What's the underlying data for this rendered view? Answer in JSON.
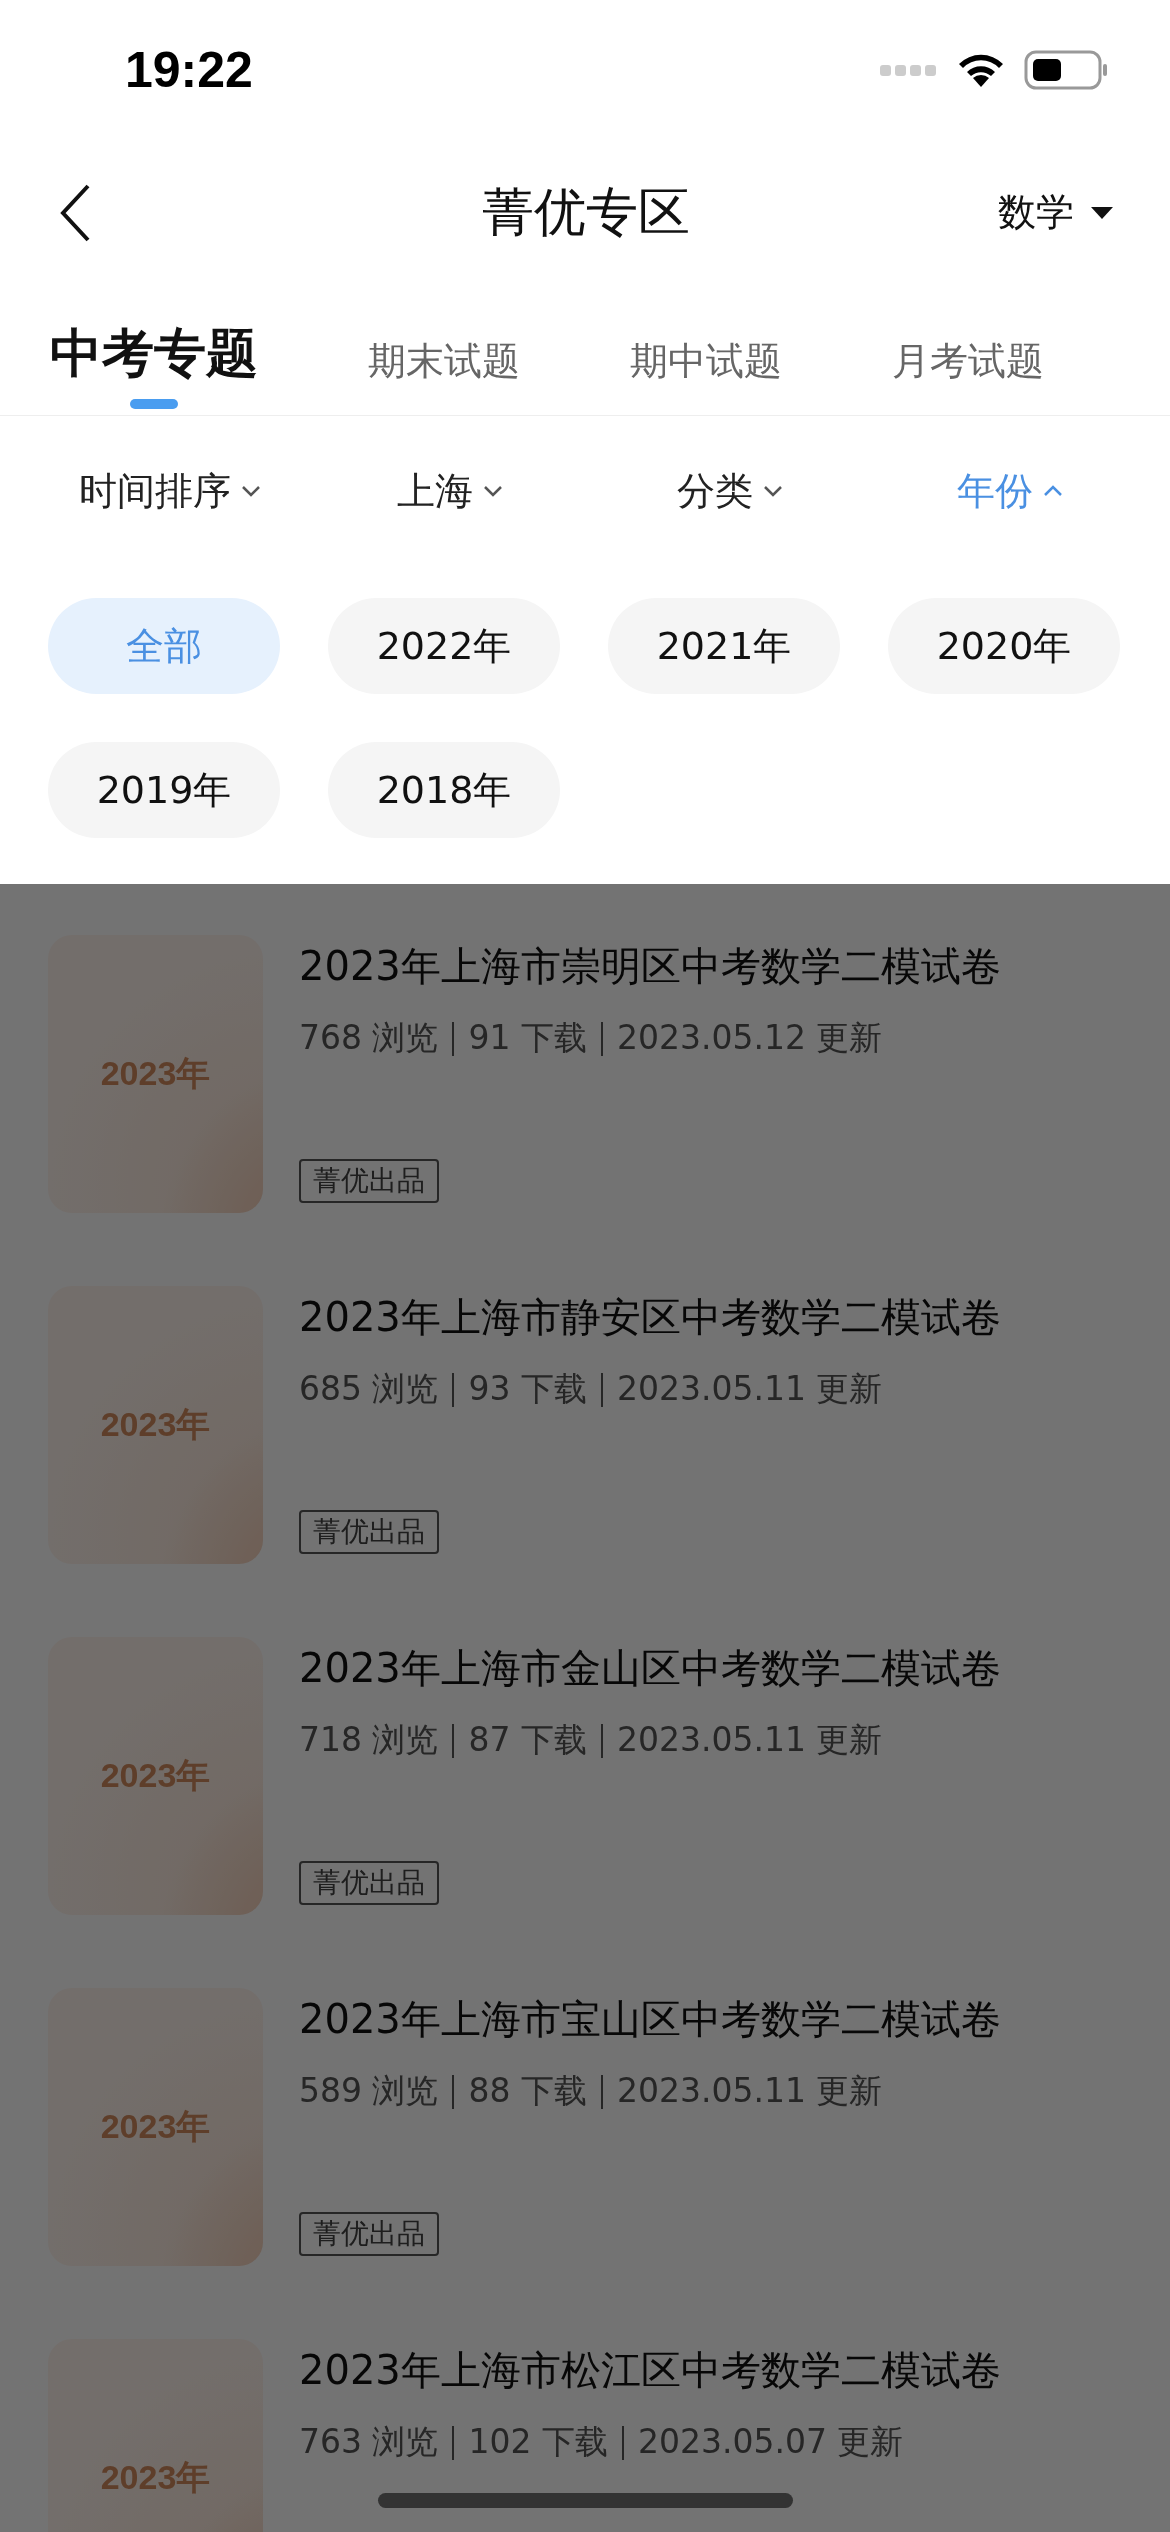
{
  "status_bar": {
    "time": "19:22"
  },
  "nav": {
    "title": "菁优专区",
    "subject": "数学"
  },
  "tabs": [
    {
      "label": "中考专题",
      "selected": true
    },
    {
      "label": "期末试题",
      "selected": false
    },
    {
      "label": "期中试题",
      "selected": false
    },
    {
      "label": "月考试题",
      "selected": false
    }
  ],
  "filters": [
    {
      "label": "时间排序",
      "open": false
    },
    {
      "label": "上海",
      "open": false
    },
    {
      "label": "分类",
      "open": false
    },
    {
      "label": "年份",
      "open": true
    }
  ],
  "year_options": [
    {
      "label": "全部",
      "selected": true
    },
    {
      "label": "2022年",
      "selected": false
    },
    {
      "label": "2021年",
      "selected": false
    },
    {
      "label": "2020年",
      "selected": false
    },
    {
      "label": "2019年",
      "selected": false
    },
    {
      "label": "2018年",
      "selected": false
    }
  ],
  "papers": [
    {
      "cover": "2023年",
      "title": "2023年上海市崇明区中考数学二模试卷",
      "views": "768 浏览",
      "downloads": "91 下载",
      "updated": "2023.05.12 更新",
      "tag": "菁优出品"
    },
    {
      "cover": "2023年",
      "title": "2023年上海市静安区中考数学二模试卷",
      "views": "685 浏览",
      "downloads": "93 下载",
      "updated": "2023.05.11 更新",
      "tag": "菁优出品"
    },
    {
      "cover": "2023年",
      "title": "2023年上海市金山区中考数学二模试卷",
      "views": "718 浏览",
      "downloads": "87 下载",
      "updated": "2023.05.11 更新",
      "tag": "菁优出品"
    },
    {
      "cover": "2023年",
      "title": "2023年上海市宝山区中考数学二模试卷",
      "views": "589 浏览",
      "downloads": "88 下载",
      "updated": "2023.05.11 更新",
      "tag": "菁优出品"
    },
    {
      "cover": "2023年",
      "title": "2023年上海市松江区中考数学二模试卷",
      "views": "763 浏览",
      "downloads": "102 下载",
      "updated": "2023.05.07 更新"
    }
  ]
}
